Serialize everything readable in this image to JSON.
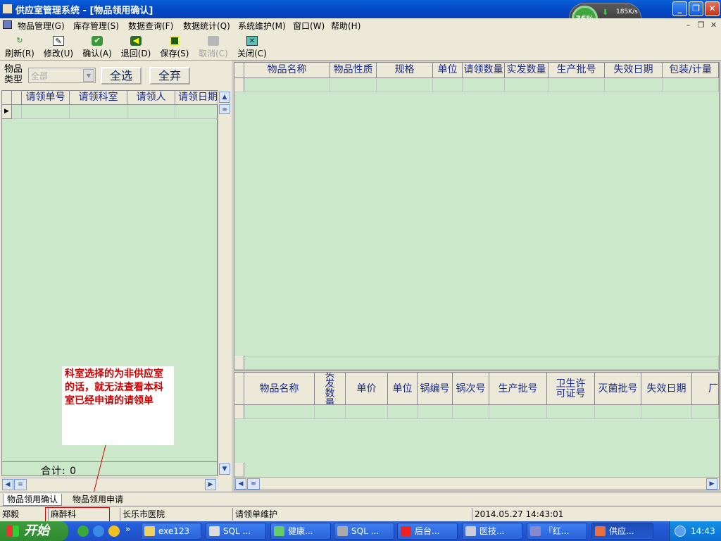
{
  "window": {
    "title": "供应室管理系统 - [物品领用确认]"
  },
  "net_widget": {
    "percent": "36%",
    "speed": "185K/s",
    "temp": "--℃"
  },
  "menu": [
    "物品管理(G)",
    "库存管理(S)",
    "数据查询(F)",
    "数据统计(Q)",
    "系统维护(M)",
    "窗口(W)",
    "帮助(H)"
  ],
  "toolbar": {
    "refresh": "刷新(R)",
    "modify": "修改(U)",
    "confirm": "确认(A)",
    "return": "退回(D)",
    "save": "保存(S)",
    "cancel": "取消(C)",
    "close": "关闭(C)"
  },
  "filter": {
    "type_label_1": "物品",
    "type_label_2": "类型",
    "type_value": "全部",
    "select_all": "全选",
    "deselect_all": "全弃"
  },
  "left_grid": {
    "headers": [
      "请领单号",
      "请领科室",
      "请领人",
      "请领日期"
    ],
    "total": "合计: 0"
  },
  "right_grid_top": {
    "headers": [
      "物品名称",
      "物品性质",
      "规格",
      "单位",
      "请领数量",
      "实发数量",
      "生产批号",
      "失效日期",
      "包装/计量"
    ]
  },
  "right_grid_bottom": {
    "headers": [
      "物品名称",
      "实发数量",
      "单价",
      "单位",
      "锅编号",
      "锅次号",
      "生产批号",
      "卫生许可证号",
      "灭菌批号",
      "失效日期",
      "厂"
    ]
  },
  "note": {
    "text": "科室选择的为非供应室的话，就无法查看本科室已经申请的请领单"
  },
  "tabs": [
    "物品领用确认",
    "物品领用申请"
  ],
  "status": {
    "user": "郑毅",
    "dept": "麻醉科",
    "hospital": "长乐市医院",
    "module": "请领单维护",
    "datetime": "2014.05.27 14:43:01"
  },
  "taskbar": {
    "start": "开始",
    "tasks": [
      "exe123",
      "SQL ...",
      "健康...",
      "SQL ...",
      "后台...",
      "医技...",
      "『红...",
      "供应..."
    ],
    "clock": "14:43"
  }
}
